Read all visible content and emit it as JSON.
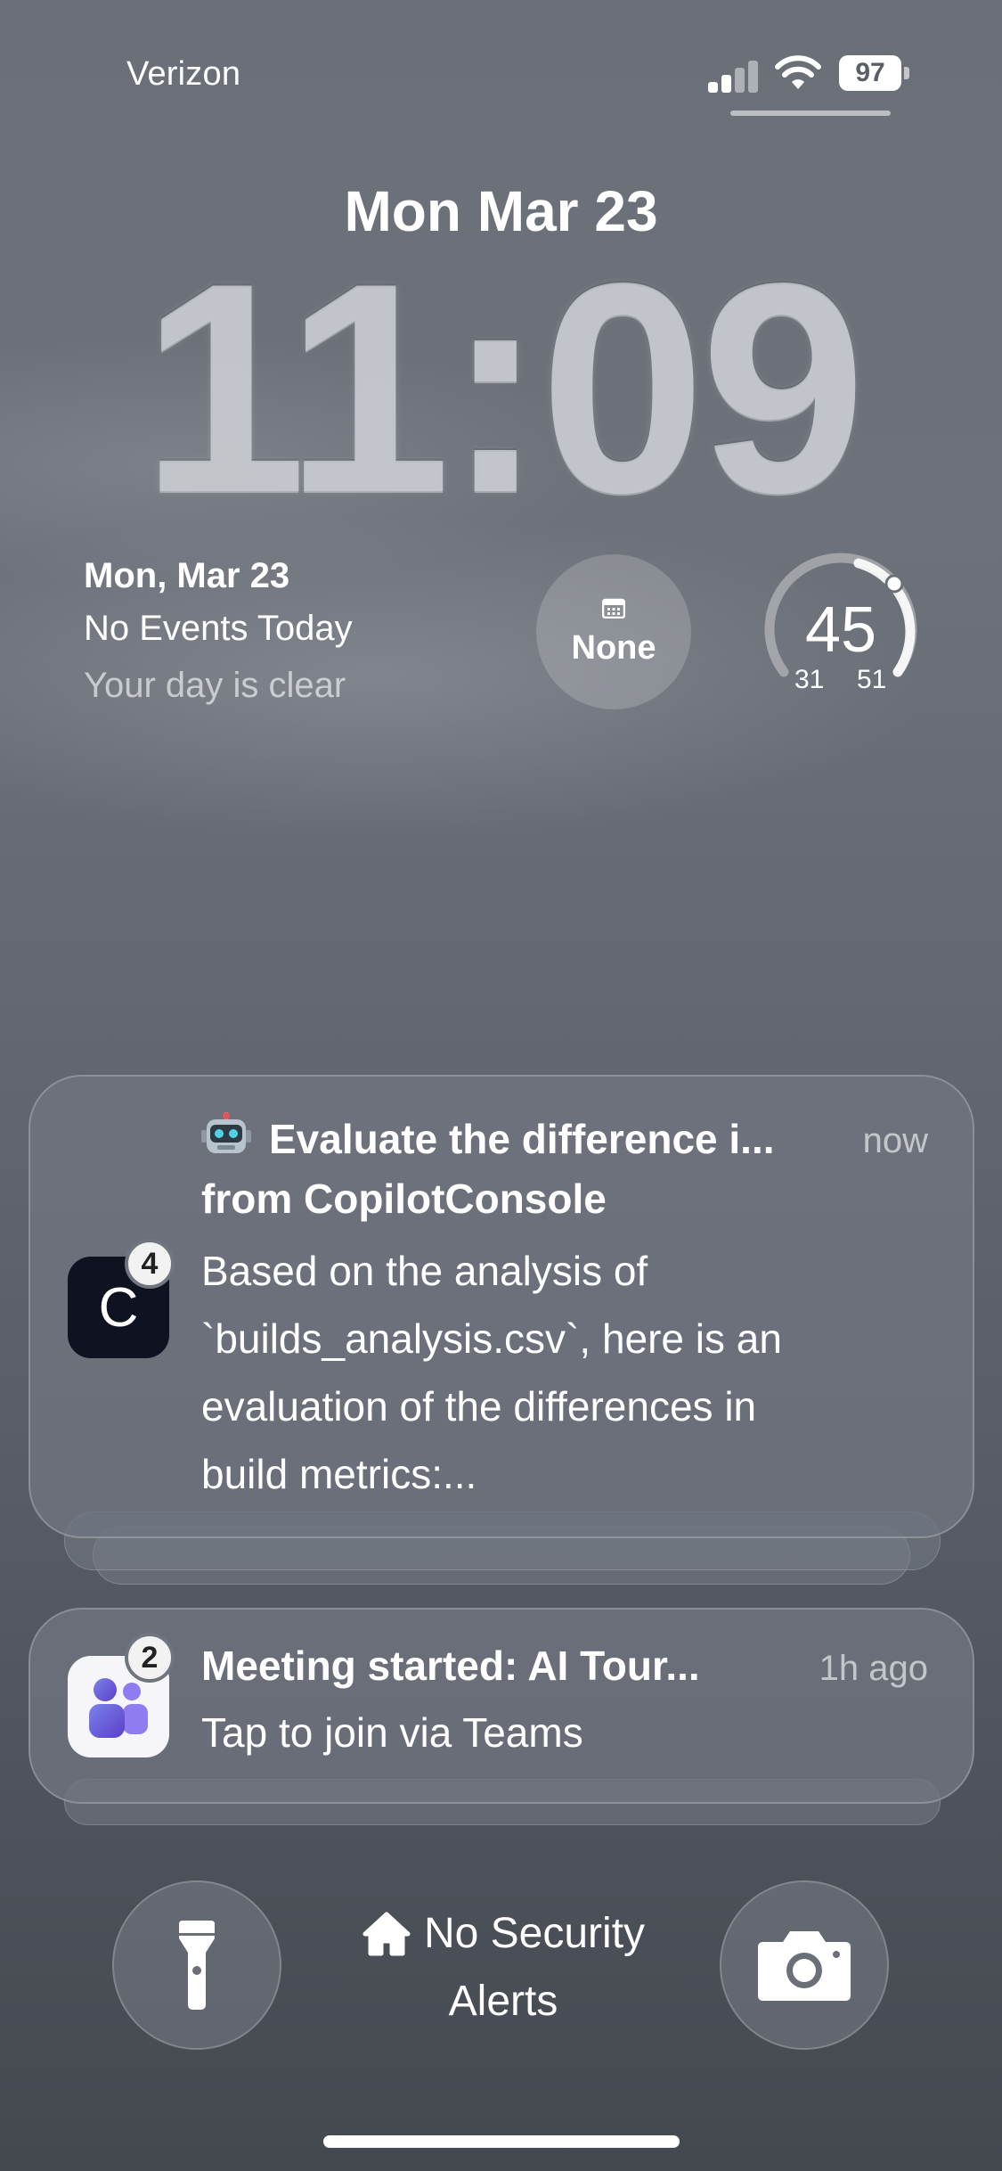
{
  "status_bar": {
    "carrier": "Verizon",
    "battery_level": "97",
    "icons": [
      "signal-icon",
      "wifi-icon",
      "battery-icon"
    ]
  },
  "lock_screen": {
    "date": "Mon Mar 23",
    "time": "11:09"
  },
  "widgets": {
    "calendar": {
      "date": "Mon, Mar 23",
      "events": "No Events Today",
      "subtitle": "Your day is clear"
    },
    "next_event": {
      "icon": "calendar-icon",
      "label": "None"
    },
    "weather": {
      "temp": "45",
      "low": "31",
      "high": "51"
    }
  },
  "notifications": [
    {
      "app_icon_letter": "C",
      "badge": "4",
      "title": "Evaluate the difference i...",
      "subtitle": "from CopilotConsole",
      "time": "now",
      "body_lines": [
        "Based on the analysis of",
        "`builds_analysis.csv`, here is an",
        "evaluation of the differences in",
        "build metrics:..."
      ]
    },
    {
      "app": "Teams",
      "badge": "2",
      "title": "Meeting started: AI Tour...",
      "time": "1h ago",
      "body": "Tap to join via Teams"
    }
  ],
  "bottom": {
    "security_line1": "No Security",
    "security_line2": "Alerts"
  },
  "colors": {
    "background_top": "#6b7078",
    "background_bottom": "#44484f",
    "copilot_icon_bg": "#0f1220",
    "teams_purple": "#6b5ce7"
  }
}
